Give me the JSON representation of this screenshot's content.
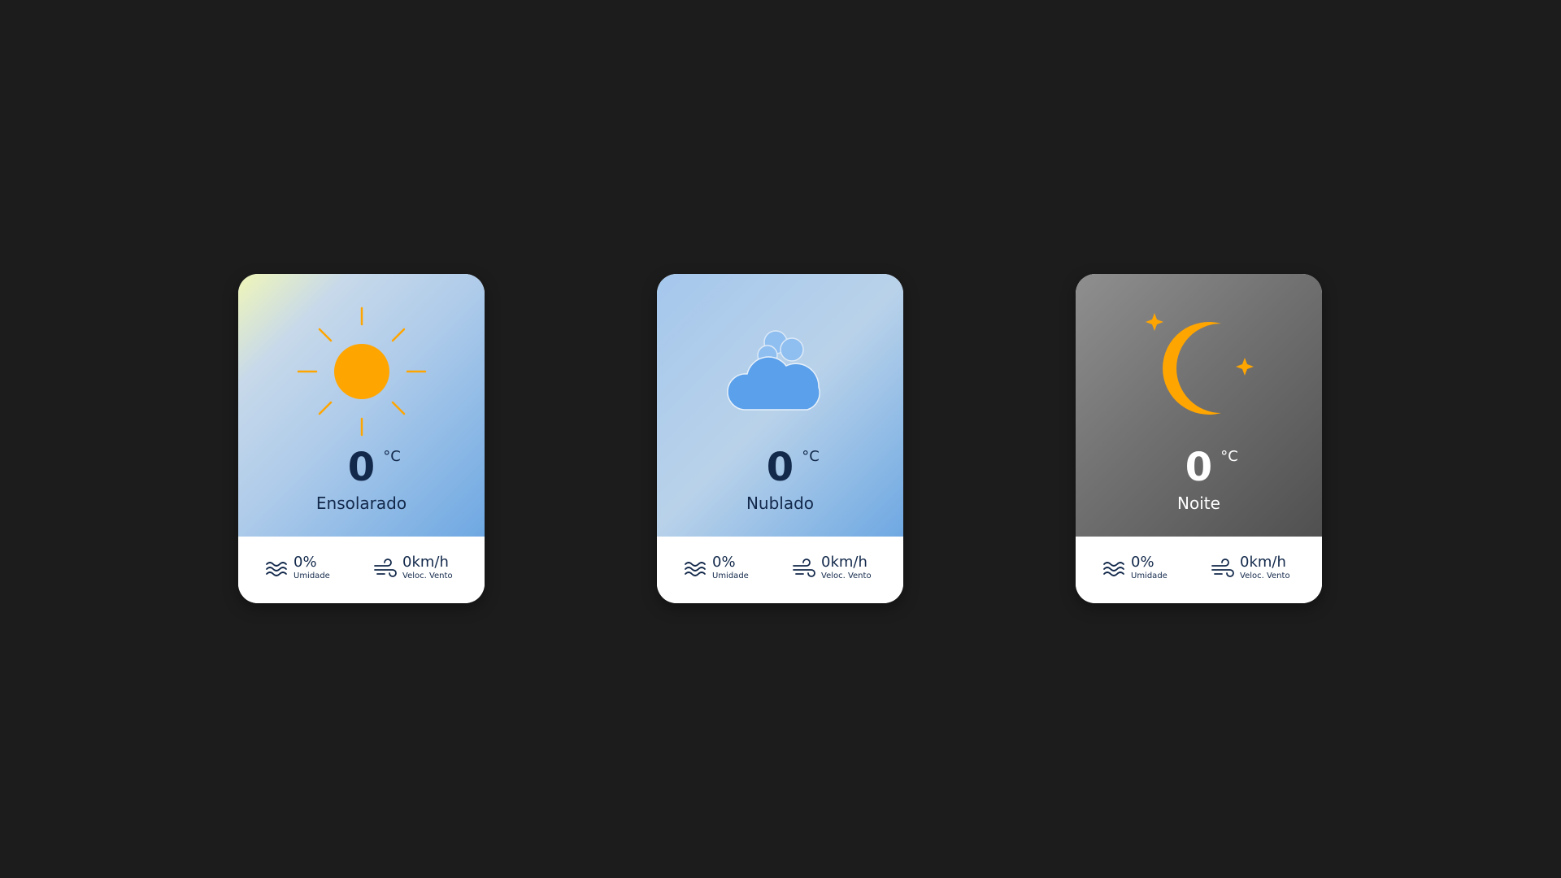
{
  "colors": {
    "background": "#1c1c1c",
    "text_dark": "#13294b",
    "accent_orange": "#ffa500",
    "cloud_blue": "#5ba0ea"
  },
  "cards": [
    {
      "temperature": "0",
      "unit": "°C",
      "condition": "Ensolarado",
      "icon": "sun-icon",
      "humidity": {
        "value": "0%",
        "label": "Umidade",
        "icon": "humidity-waves-icon"
      },
      "wind": {
        "value": "0km/h",
        "label": "Veloc. Vento",
        "icon": "wind-icon"
      }
    },
    {
      "temperature": "0",
      "unit": "°C",
      "condition": "Nublado",
      "icon": "cloud-icon",
      "humidity": {
        "value": "0%",
        "label": "Umidade",
        "icon": "humidity-waves-icon"
      },
      "wind": {
        "value": "0km/h",
        "label": "Veloc. Vento",
        "icon": "wind-icon"
      }
    },
    {
      "temperature": "0",
      "unit": "°C",
      "condition": "Noite",
      "icon": "moon-stars-icon",
      "humidity": {
        "value": "0%",
        "label": "Umidade",
        "icon": "humidity-waves-icon"
      },
      "wind": {
        "value": "0km/h",
        "label": "Veloc. Vento",
        "icon": "wind-icon"
      }
    }
  ]
}
